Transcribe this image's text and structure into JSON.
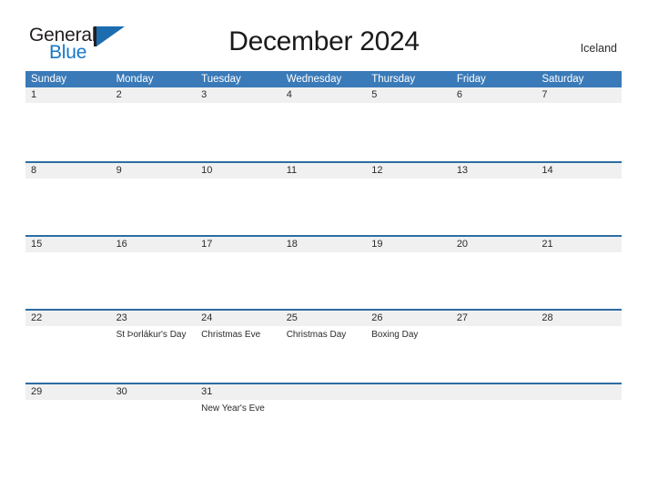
{
  "brand": {
    "name_part1": "General",
    "name_part2": "Blue",
    "flag_icon": "flag-triangle-icon",
    "color_dark": "#231f20",
    "color_blue": "#1878c8"
  },
  "header": {
    "title": "December 2024",
    "region": "Iceland"
  },
  "theme": {
    "header_blue": "#3a7ab8",
    "row_divider_blue": "#2e6da4",
    "band_gray": "#f0f0f0",
    "text_dark": "#2b2b2b"
  },
  "calendar": {
    "month": "December",
    "year": "2024",
    "weekdays": [
      "Sunday",
      "Monday",
      "Tuesday",
      "Wednesday",
      "Thursday",
      "Friday",
      "Saturday"
    ],
    "weeks": [
      [
        {
          "date": "1",
          "events": []
        },
        {
          "date": "2",
          "events": []
        },
        {
          "date": "3",
          "events": []
        },
        {
          "date": "4",
          "events": []
        },
        {
          "date": "5",
          "events": []
        },
        {
          "date": "6",
          "events": []
        },
        {
          "date": "7",
          "events": []
        }
      ],
      [
        {
          "date": "8",
          "events": []
        },
        {
          "date": "9",
          "events": []
        },
        {
          "date": "10",
          "events": []
        },
        {
          "date": "11",
          "events": []
        },
        {
          "date": "12",
          "events": []
        },
        {
          "date": "13",
          "events": []
        },
        {
          "date": "14",
          "events": []
        }
      ],
      [
        {
          "date": "15",
          "events": []
        },
        {
          "date": "16",
          "events": []
        },
        {
          "date": "17",
          "events": []
        },
        {
          "date": "18",
          "events": []
        },
        {
          "date": "19",
          "events": []
        },
        {
          "date": "20",
          "events": []
        },
        {
          "date": "21",
          "events": []
        }
      ],
      [
        {
          "date": "22",
          "events": []
        },
        {
          "date": "23",
          "events": [
            "St Þorlákur's Day"
          ]
        },
        {
          "date": "24",
          "events": [
            "Christmas Eve"
          ]
        },
        {
          "date": "25",
          "events": [
            "Christmas Day"
          ]
        },
        {
          "date": "26",
          "events": [
            "Boxing Day"
          ]
        },
        {
          "date": "27",
          "events": []
        },
        {
          "date": "28",
          "events": []
        }
      ],
      [
        {
          "date": "29",
          "events": []
        },
        {
          "date": "30",
          "events": []
        },
        {
          "date": "31",
          "events": [
            "New Year's Eve"
          ]
        },
        {
          "date": "",
          "events": []
        },
        {
          "date": "",
          "events": []
        },
        {
          "date": "",
          "events": []
        },
        {
          "date": "",
          "events": []
        }
      ]
    ]
  }
}
